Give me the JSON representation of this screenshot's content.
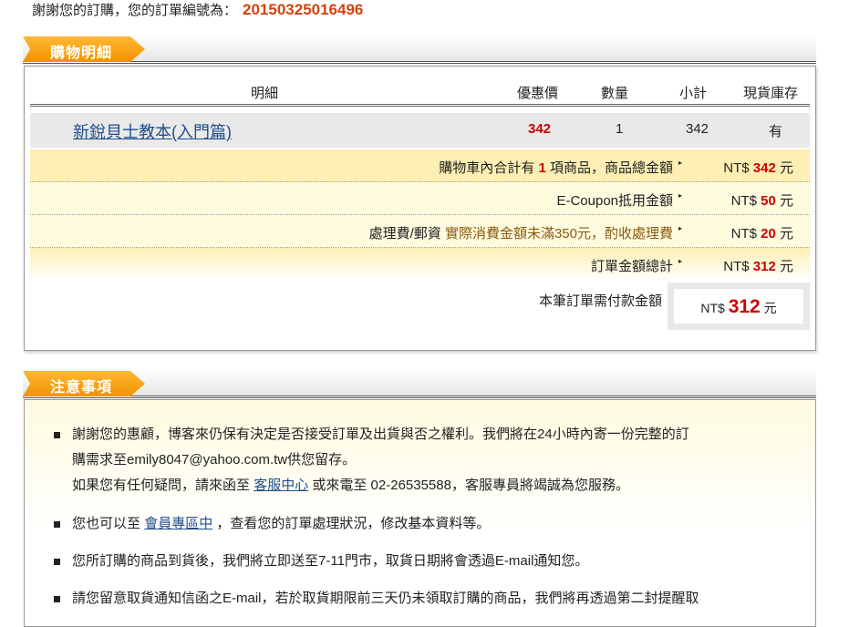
{
  "header": {
    "thanks": "謝謝您的訂購，您的訂單編號為：",
    "order_no": "20150325016496"
  },
  "cart": {
    "tab": "購物明細",
    "columns": [
      "明細",
      "優惠價",
      "數量",
      "小計",
      "現貨庫存"
    ],
    "item": {
      "name": "新銳貝士教本(入門篇)",
      "price": "342",
      "qty": "1",
      "subtotal": "342",
      "stock": "有"
    },
    "summary": {
      "total_a": "購物車內合計有",
      "total_count": "1",
      "total_b": "項商品，商品總金額",
      "total_amt": "342",
      "coupon": "E-Coupon抵用金額",
      "coupon_amt": "50",
      "fee": "處理費/郵資",
      "fee_note": "實際消費金額未滿350元，酌收處理費",
      "fee_amt": "20",
      "grand": "訂單金額總計",
      "grand_amt": "312",
      "pay": "本筆訂單需付款金額",
      "pay_amt": "312",
      "currency": "NT$",
      "unit": "元",
      "arrow": "▸"
    }
  },
  "notes": {
    "tab": "注意事項",
    "n1a": "謝謝您的惠顧，博客來仍保有決定是否接受訂單及出貨與否之權利。我們將在24小時內寄一份完整的訂",
    "n1b": "購需求至emily8047@yahoo.com.tw供您留存。",
    "n1c": "如果您有任何疑問，請來函至",
    "n1link": "客服中心",
    "n1d": "或來電至 02-26535588，客服專員將竭誠為您服務。",
    "n2a": "您也可以至",
    "n2link": "會員專區中",
    "n2b": "，查看您的訂單處理狀況，修改基本資料等。",
    "n3": "您所訂購的商品到貨後，我們將立即送至7-11門市，取貨日期將會透過E-mail通知您。",
    "n4": "請您留意取貨通知信函之E-mail，若於取貨期限前三天仍未領取訂購的商品，我們將再透過第二封提醒取"
  }
}
